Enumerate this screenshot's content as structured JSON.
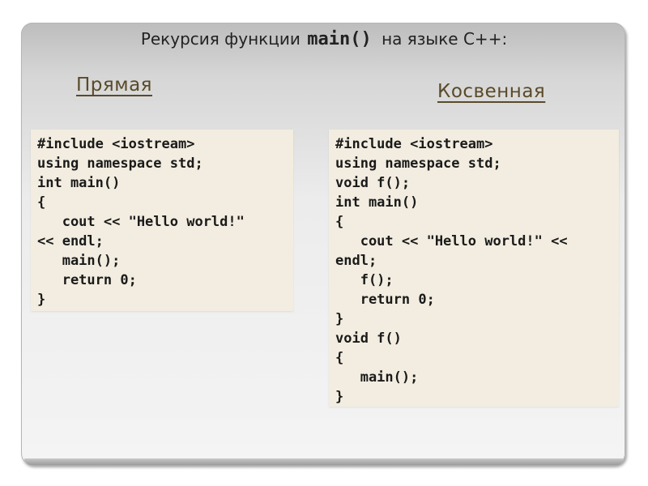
{
  "title": {
    "prefix": "Рекурсия функции",
    "function_name": "main()",
    "suffix": "на языке С++:"
  },
  "direct": {
    "heading": "Прямая",
    "code": "#include <iostream>\nusing namespace std;\nint main()\n{\n   cout << \"Hello world!\"\n<< endl;\n   main();\n   return 0;\n}"
  },
  "indirect": {
    "heading": "Косвенная",
    "code": "#include <iostream>\nusing namespace std;\nvoid f();\nint main()\n{\n   cout << \"Hello world!\" <<\nendl;\n   f();\n   return 0;\n}\nvoid f()\n{\n   main();\n}"
  },
  "colors": {
    "heading": "#5a4a2a",
    "code_background": "#f2ede0"
  }
}
